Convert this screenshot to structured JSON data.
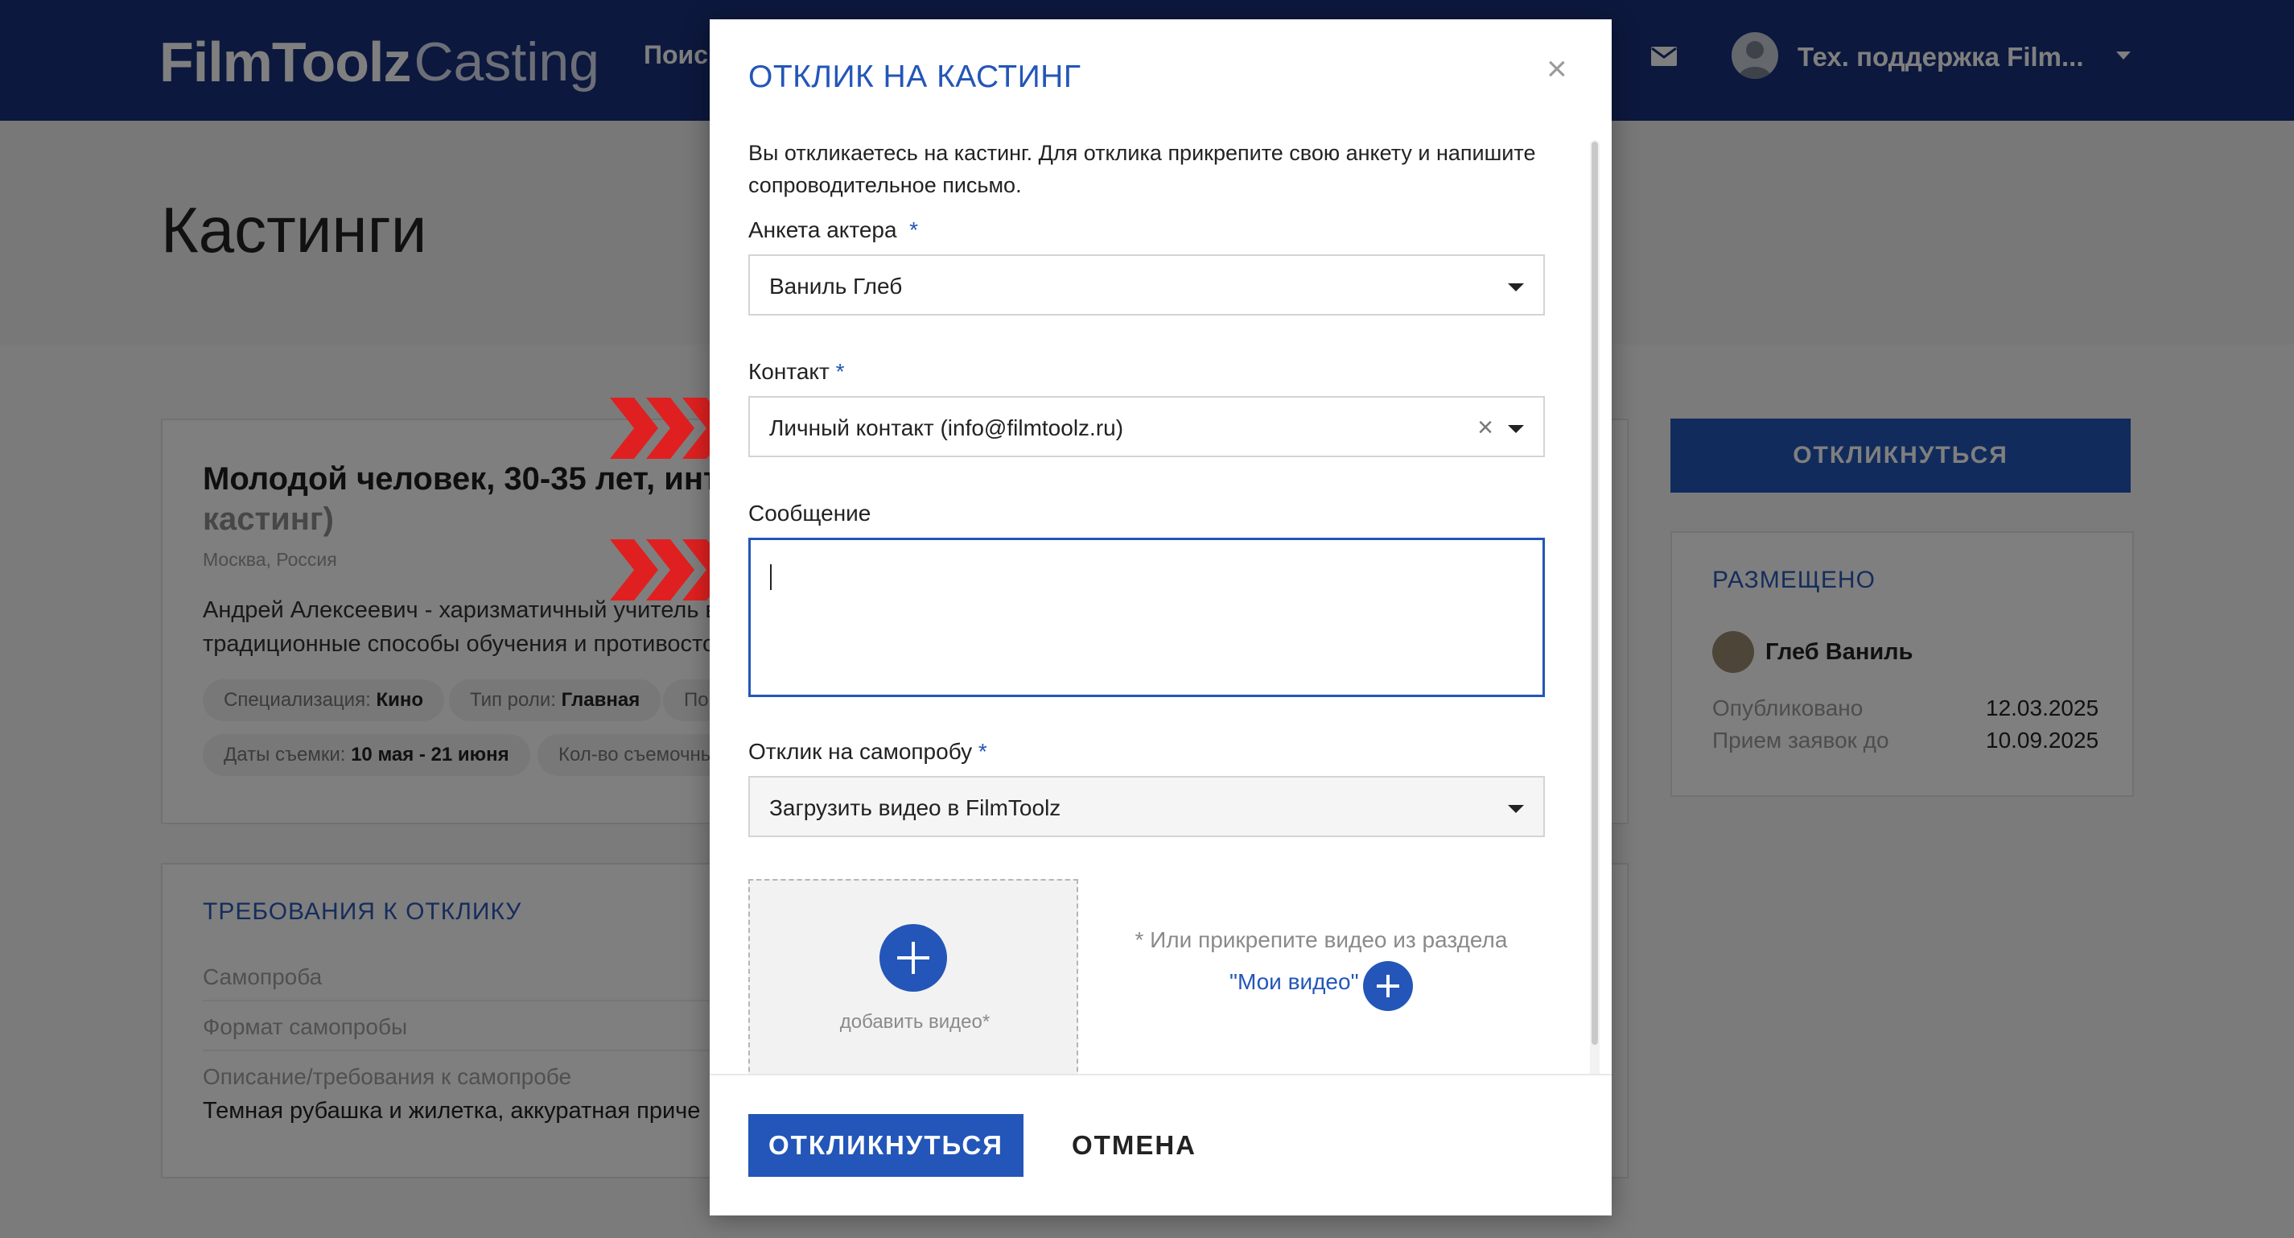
{
  "app": {
    "logo_bold": "FilmToolz",
    "logo_thin": "Casting",
    "nav_search": "Поис",
    "mail_icon": "envelope-icon",
    "user_name": "Тех. поддержка Film..."
  },
  "page": {
    "title": "Кастинги",
    "casting": {
      "title": "Молодой человек, 30-35 лет, инте",
      "title_muted": "кастинг)",
      "location": "Москва, Россия",
      "description_line1": "Андрей Алексеевич - харизматичный учитель в",
      "description_line2": "традиционные способы обучения и противосто",
      "chips": [
        {
          "label": "Специализация:",
          "value": "Кино"
        },
        {
          "label": "Тип роли:",
          "value": "Главная"
        },
        {
          "label": "По",
          "value": ""
        },
        {
          "label": "Даты съемки:",
          "value": "10 мая - 21 июня"
        },
        {
          "label": "Кол-во съемочны",
          "value": ""
        }
      ]
    },
    "requirements": {
      "title": "ТРЕБОВАНИЯ К ОТКЛИКУ",
      "rows": [
        "Самопроба",
        "Формат самопробы",
        "Описание/требования к самопробе"
      ],
      "value": "Темная рубашка и жилетка, аккуратная приче"
    },
    "side": {
      "respond_button": "ОТКЛИКНУТЬСЯ",
      "posted_title": "РАЗМЕЩЕНО",
      "author": "Глеб Ваниль",
      "published_label": "Опубликовано",
      "published_value": "12.03.2025",
      "deadline_label": "Прием заявок до",
      "deadline_value": "10.09.2025"
    }
  },
  "modal": {
    "title": "ОТКЛИК НА КАСТИНГ",
    "close": "×",
    "intro": "Вы откликаетесь на кастинг. Для отклика прикрепите свою анкету и напишите сопроводительное письмо.",
    "actor_label": "Анкета актера",
    "actor_value": "Ваниль Глеб",
    "contact_label": "Контакт",
    "contact_value": "Личный контакт (info@filmtoolz.ru)",
    "message_label": "Сообщение",
    "selftape_label": "Отклик на самопробу",
    "selftape_value": "Загрузить видео в FilmToolz",
    "add_video": "добавить видео*",
    "hint": "* Или прикрепите видео из раздела",
    "my_videos": "\"Мои видео\"",
    "submit": "ОТКЛИКНУТЬСЯ",
    "cancel": "ОТМЕНА",
    "required_mark": "*"
  },
  "colors": {
    "brand": "#18307a",
    "accent": "#2356b8",
    "marker": "#e02020"
  }
}
